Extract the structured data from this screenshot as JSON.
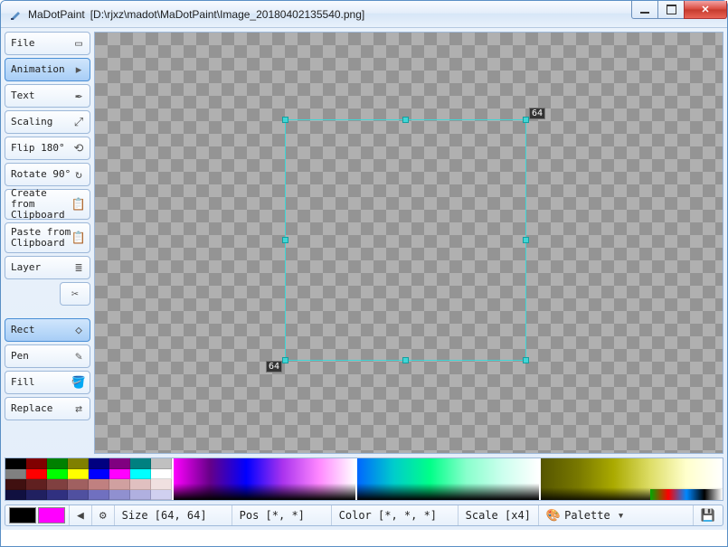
{
  "window": {
    "app_name": "MaDotPaint",
    "document_path": "[D:\\rjxz\\madot\\MaDotPaint\\Image_20180402135540.png]"
  },
  "toolbar": {
    "file": "File",
    "animation": "Animation",
    "text": "Text",
    "scaling": "Scaling",
    "flip": "Flip 180°",
    "rotate": "Rotate 90°",
    "create_clip": "Create from\nClipboard",
    "paste_clip": "Paste from\nClipboard",
    "layer": "Layer",
    "rect": "Rect",
    "pen": "Pen",
    "fill": "Fill",
    "replace": "Replace"
  },
  "canvas": {
    "selection_width": "64",
    "selection_height": "64"
  },
  "palette_swatches": [
    "#000000",
    "#800000",
    "#008000",
    "#808000",
    "#000080",
    "#800080",
    "#008080",
    "#c0c0c0",
    "#808080",
    "#ff0000",
    "#00ff00",
    "#ffff00",
    "#0000ff",
    "#ff00ff",
    "#00ffff",
    "#ffffff",
    "#401010",
    "#602020",
    "#804040",
    "#a06060",
    "#c08080",
    "#d0a0a0",
    "#e0c0c0",
    "#f0e0e0",
    "#101040",
    "#202060",
    "#303080",
    "#5050a0",
    "#7070c0",
    "#9090d0",
    "#b0b0e0",
    "#d0d0f0"
  ],
  "status": {
    "primary_color": "#000000",
    "secondary_color": "#ff00ff",
    "size_label": "Size [64, 64]",
    "pos_label": "Pos [*, *]",
    "color_label": "Color [*, *, *]",
    "scale_label": "Scale [x4]",
    "palette_label": "Palette"
  }
}
